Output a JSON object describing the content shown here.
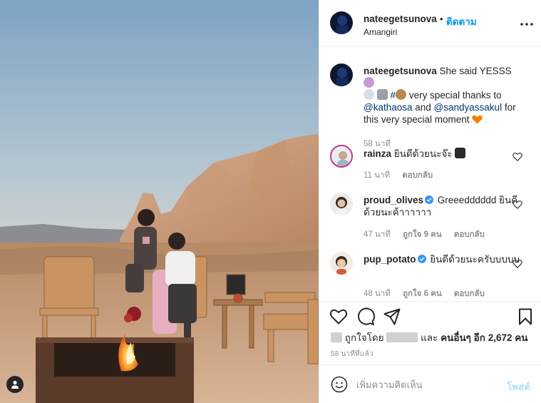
{
  "post": {
    "username": "nateegetsunova",
    "follow_dot": "•",
    "follow_label": "ติดตาม",
    "location": "Amangiri"
  },
  "caption": {
    "username": "nateegetsunova",
    "text_1": "She said YESSS",
    "hashtag": "#",
    "text_2": "very special thanks to",
    "mention_1": "@kathaosa",
    "and": "and",
    "mention_2": "@sandyassakul",
    "text_3": "for this very special moment",
    "time": "58 นาที"
  },
  "comments": [
    {
      "username": "rainza",
      "text": "ยินดีด้วยนะจ๊ะ",
      "time": "11 นาที",
      "likes": "",
      "reply": "ตอบกลับ",
      "verified": false
    },
    {
      "username": "proud_olives",
      "text": "Greeedddddd ยินดีด้วยนะค้าาาาาา",
      "time": "47 นาที",
      "likes": "ถูกใจ 9 คน",
      "reply": "ตอบกลับ",
      "verified": true
    },
    {
      "username": "pup_potato",
      "text": "ยินดีด้วยนะครับบบบบ",
      "time": "48 นาที",
      "likes": "ถูกใจ 6 คน",
      "reply": "ตอบกลับ",
      "verified": true
    }
  ],
  "likes": {
    "prefix": "ถูกใจโดย",
    "and": "และ",
    "others_label": "คนอื่นๆ อีก 2,672 คน"
  },
  "timestamp": "58 นาทีที่แล้ว",
  "comment_box": {
    "placeholder": "เพิ่มความคิดเห็น",
    "post_label": "โพสต์"
  },
  "icons": {
    "more": "more-horizontal-icon",
    "like": "heart-icon",
    "comment": "comment-icon",
    "share": "share-icon",
    "save": "bookmark-icon",
    "emoji": "smile-icon",
    "user_tag": "user-tag-icon"
  },
  "colors": {
    "link": "#0095f6",
    "mention": "#00376b",
    "muted": "#8e8e8e",
    "post_disabled": "#b2dffc",
    "verified": "#3897f0",
    "heart_emoji": "#f77f00"
  }
}
